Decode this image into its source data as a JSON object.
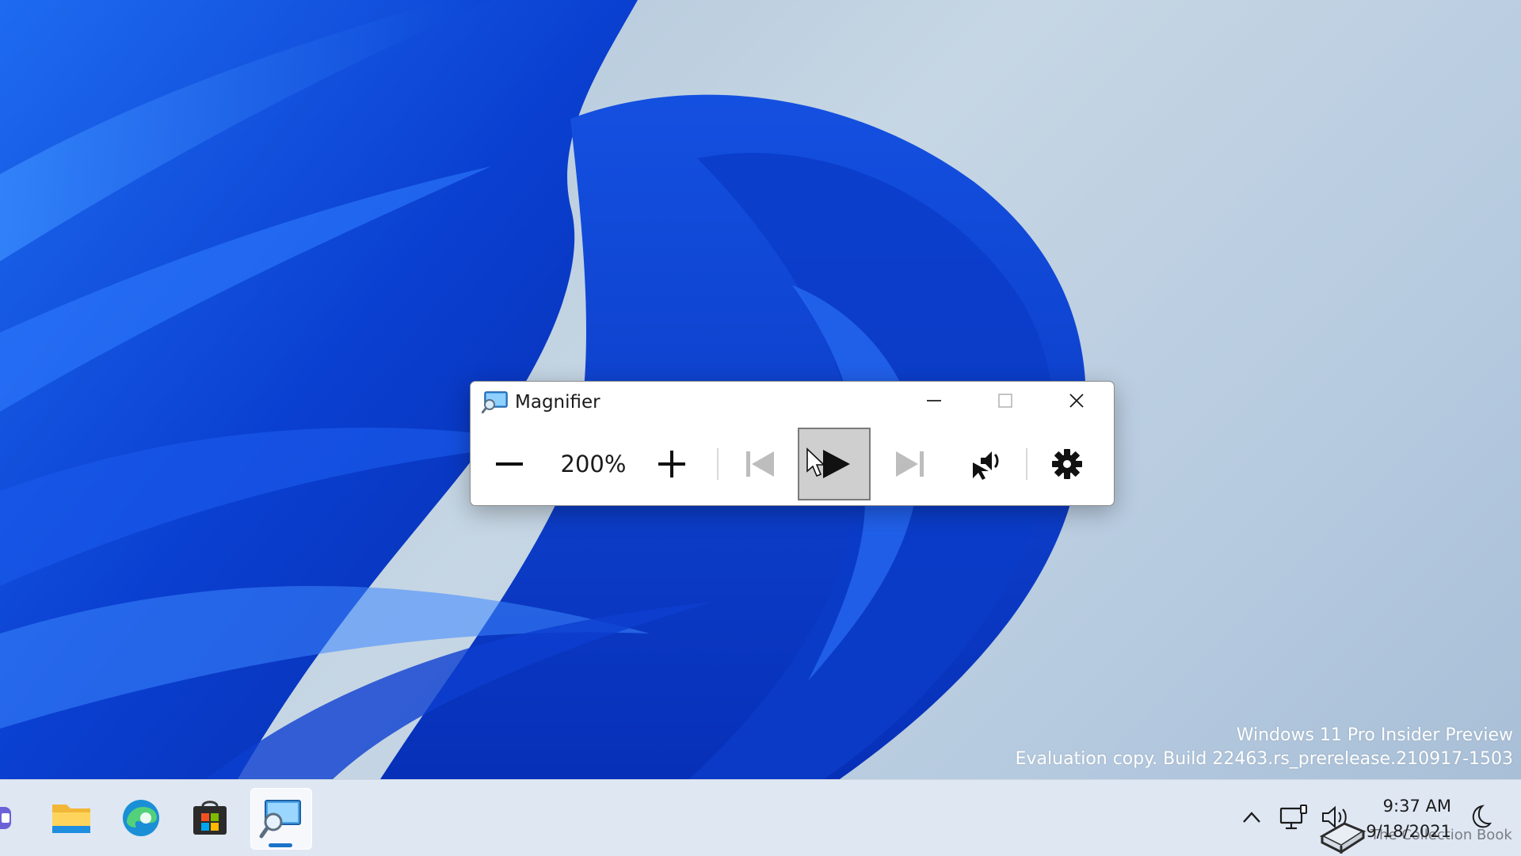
{
  "desktop": {
    "watermark_line1": "Windows 11 Pro Insider Preview",
    "watermark_line2": "Evaluation copy. Build 22463.rs_prerelease.210917-1503"
  },
  "magnifier": {
    "title": "Magnifier",
    "zoom_level": "200%",
    "buttons": {
      "minimize": "minimize-icon",
      "maximize": "maximize-icon",
      "close": "close-icon",
      "zoom_out": "minus-icon",
      "zoom_in": "plus-icon",
      "previous": "skip-previous-icon",
      "play": "play-icon",
      "next": "skip-next-icon",
      "read_from_here": "speaker-pointer-icon",
      "settings": "gear-icon"
    },
    "colors": {
      "window_bg": "#ffffff",
      "active_button_bg": "#cfcfcf"
    }
  },
  "taskbar": {
    "apps": [
      {
        "name": "Chat",
        "icon": "chat-icon"
      },
      {
        "name": "File Explorer",
        "icon": "folder-icon"
      },
      {
        "name": "Microsoft Edge",
        "icon": "edge-icon"
      },
      {
        "name": "Microsoft Store",
        "icon": "store-icon"
      },
      {
        "name": "Magnifier",
        "icon": "magnifier-icon",
        "active": true
      }
    ],
    "tray_icons": [
      "chevron-up-icon",
      "network-icon",
      "volume-icon",
      "moon-icon"
    ],
    "clock_time": "9:37 AM",
    "clock_date": "9/18/2021",
    "overlay_watermark": "The Collection Book",
    "accent_color": "#1a73c8"
  }
}
